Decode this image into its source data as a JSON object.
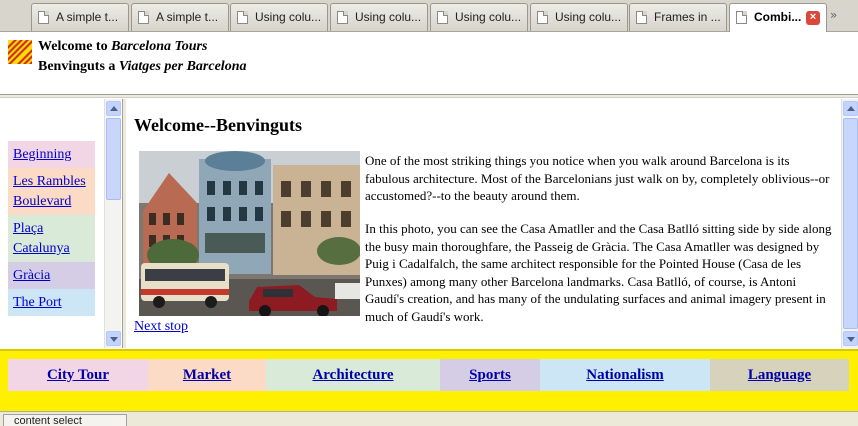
{
  "browser": {
    "tabs": [
      {
        "title": "A simple t...",
        "active": false
      },
      {
        "title": "A simple t...",
        "active": false
      },
      {
        "title": "Using colu...",
        "active": false
      },
      {
        "title": "Using colu...",
        "active": false
      },
      {
        "title": "Using colu...",
        "active": false
      },
      {
        "title": "Using colu...",
        "active": false
      },
      {
        "title": "Frames in ...",
        "active": false
      },
      {
        "title": "Combi...",
        "active": true
      }
    ],
    "close_glyph": "×",
    "tab_scroll_glyph": "»",
    "status_text": "content select"
  },
  "header": {
    "line1_prefix": "Welcome to ",
    "line1_emph": "Barcelona Tours",
    "line2_prefix": "Benvinguts a ",
    "line2_emph": "Viatges per Barcelona"
  },
  "side_nav": {
    "items": [
      {
        "label": "Beginning",
        "bg": "#f2d6e6"
      },
      {
        "label": "Les Rambles Boulevard",
        "bg": "#fbdbc5"
      },
      {
        "label": "Plaça Catalunya",
        "bg": "#d9ead9"
      },
      {
        "label": "Gràcia",
        "bg": "#d5cde6"
      },
      {
        "label": "The Port",
        "bg": "#cde6f5"
      }
    ]
  },
  "main": {
    "title": "Welcome--Benvinguts",
    "paragraph1": "One of the most striking things you notice when you walk around Barcelona is its fabulous architecture. Most of the Barcelonians just walk on by, completely oblivious--or accustomed?--to the beauty around them.",
    "paragraph2": "In this photo, you can see the Casa Amatller and the Casa Batlló sitting side by side along the busy main thoroughfare, the Passeig de Gràcia. The Casa Amatller was designed by Puig i Cadalfalch, the same architect responsible for the Pointed House (Casa de les Punxes) among many other Barcelona landmarks. Casa Batlló, of course, is Antoni Gaudí's creation, and has many of the undulating surfaces and animal imagery present in much of Gaudí's work.",
    "next_link": "Next stop"
  },
  "top_nav": {
    "items": [
      {
        "label": "City Tour",
        "bg": "#f2d6e6"
      },
      {
        "label": "Market",
        "bg": "#fbdbc5"
      },
      {
        "label": "Architecture",
        "bg": "#d9ead9"
      },
      {
        "label": "Sports",
        "bg": "#d5cde6"
      },
      {
        "label": "Nationalism",
        "bg": "#cde6f5"
      },
      {
        "label": "Language",
        "bg": "#d6d2bc"
      }
    ]
  },
  "colors": {
    "link": "#0000cc",
    "bottom_frame_bg": "#ffef00",
    "flag_red": "#d52b1e",
    "flag_yellow": "#fcdd09"
  }
}
